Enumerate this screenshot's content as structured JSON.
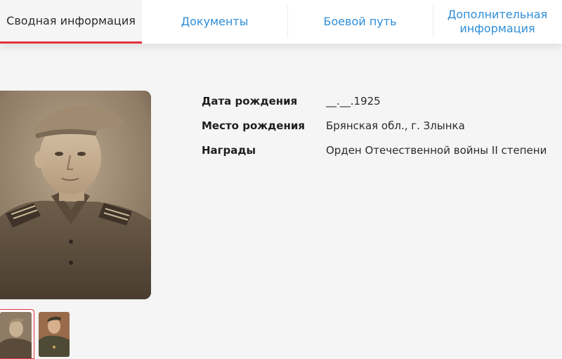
{
  "tabs": [
    {
      "label": "Сводная информация",
      "active": true
    },
    {
      "label": "Документы",
      "active": false
    },
    {
      "label": "Боевой путь",
      "active": false
    },
    {
      "label": "Дополнительная информация",
      "active": false
    }
  ],
  "info": [
    {
      "label": "Дата рождения",
      "value": "__.__.1925"
    },
    {
      "label": "Место рождения",
      "value": "Брянская обл., г. Злынка"
    },
    {
      "label": "Награды",
      "value": "Орден Отечественной войны II степени"
    }
  ],
  "colors": {
    "accent": "#e5323b",
    "link": "#2f8ed8",
    "background": "#f5f5f5"
  }
}
